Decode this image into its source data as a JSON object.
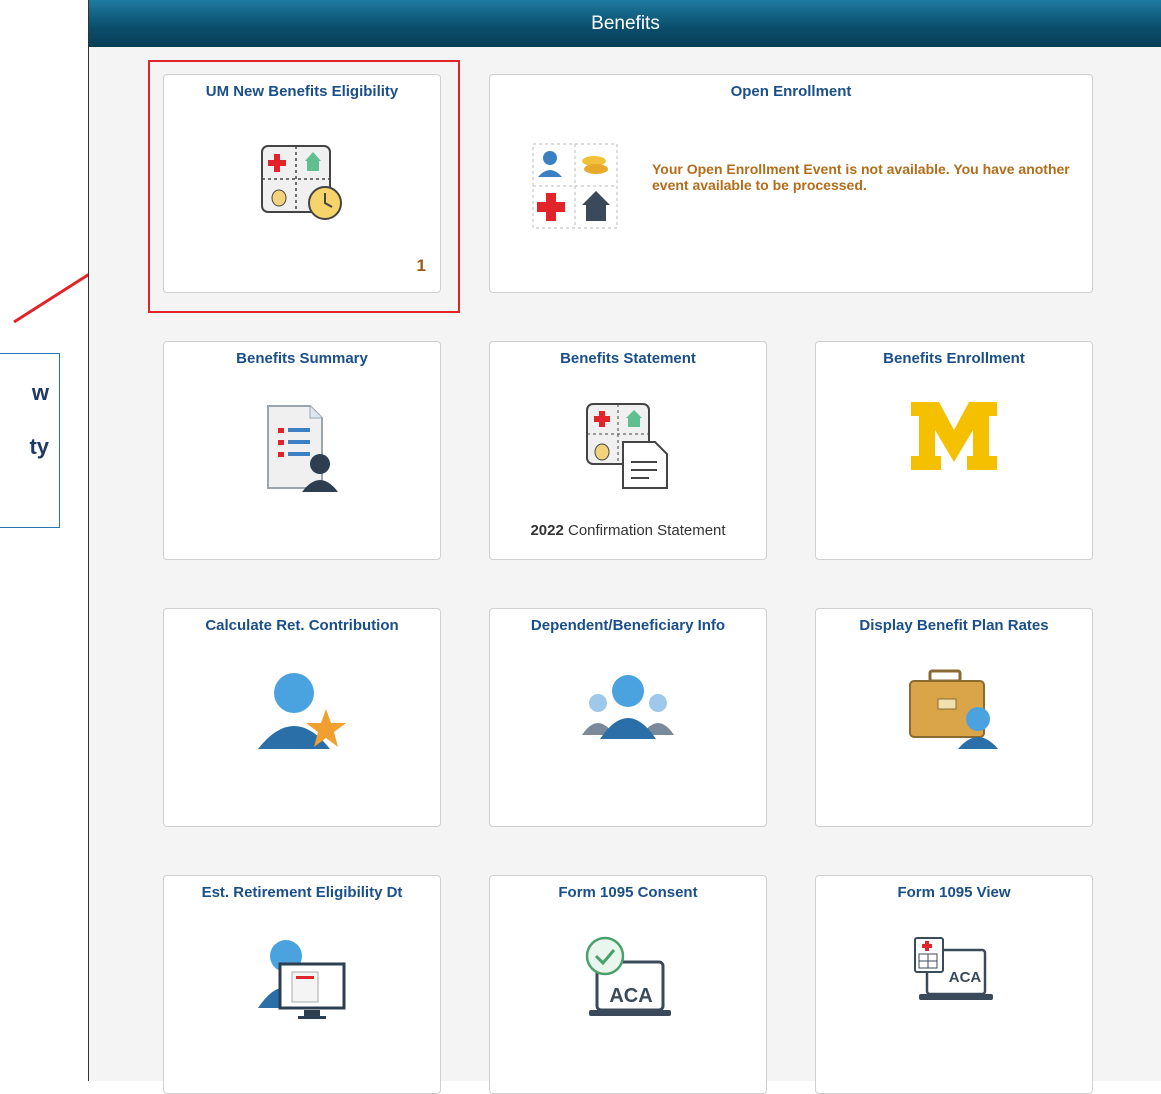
{
  "header": {
    "title": "Benefits"
  },
  "tiles": [
    {
      "title": "UM New Benefits Eligibility",
      "badge": "1"
    },
    {
      "title": "Open Enrollment",
      "message": "Your Open Enrollment Event is not available. You have another event available to be processed."
    },
    {
      "title": "Benefits Summary"
    },
    {
      "title": "Benefits Statement",
      "caption_year": "2022",
      "caption_text": " Confirmation Statement"
    },
    {
      "title": "Benefits Enrollment"
    },
    {
      "title": "Calculate Ret. Contribution"
    },
    {
      "title": "Dependent/Beneficiary Info"
    },
    {
      "title": "Display Benefit Plan Rates"
    },
    {
      "title": "Est. Retirement Eligibility Dt"
    },
    {
      "title": "Form 1095 Consent",
      "icon_text": "ACA"
    },
    {
      "title": "Form 1095 View",
      "icon_text": "ACA"
    }
  ],
  "callout": {
    "line1": "w",
    "line2": "ty"
  },
  "colors": {
    "header": "#0a4d6b",
    "tile_title": "#1a4f89",
    "highlight": "#e0242a",
    "warning_text": "#b36d1a",
    "um_maize": "#f5c000"
  },
  "icons": [
    "benefits-eligibility-icon",
    "open-enrollment-icon",
    "benefits-summary-icon",
    "benefits-statement-icon",
    "michigan-m-logo",
    "retirement-contribution-icon",
    "dependents-icon",
    "plan-rates-icon",
    "retirement-date-icon",
    "form-1095-consent-icon",
    "form-1095-view-icon"
  ]
}
